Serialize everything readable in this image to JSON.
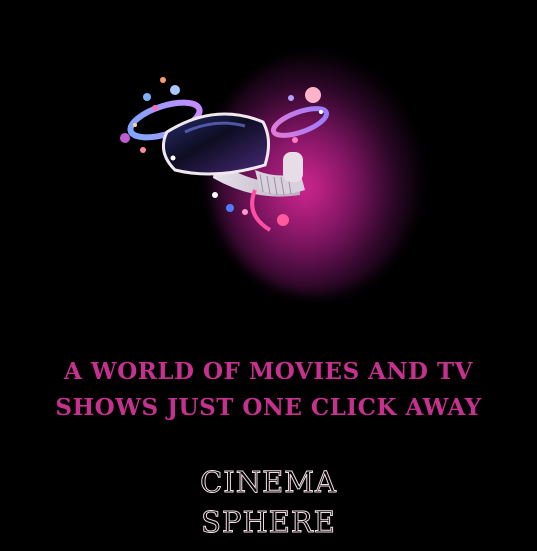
{
  "hero": {
    "tagline_line1": "A WORLD OF MOVIES AND TV",
    "tagline_line2": "SHOWS JUST ONE CLICK AWAY",
    "illustration_icon": "vr-headset-icon"
  },
  "brand": {
    "line1": "CINEMA",
    "line2": "SPHERE"
  },
  "colors": {
    "background": "#000000",
    "accent": "#c6318f",
    "brand_outline": "#f2dce4"
  }
}
